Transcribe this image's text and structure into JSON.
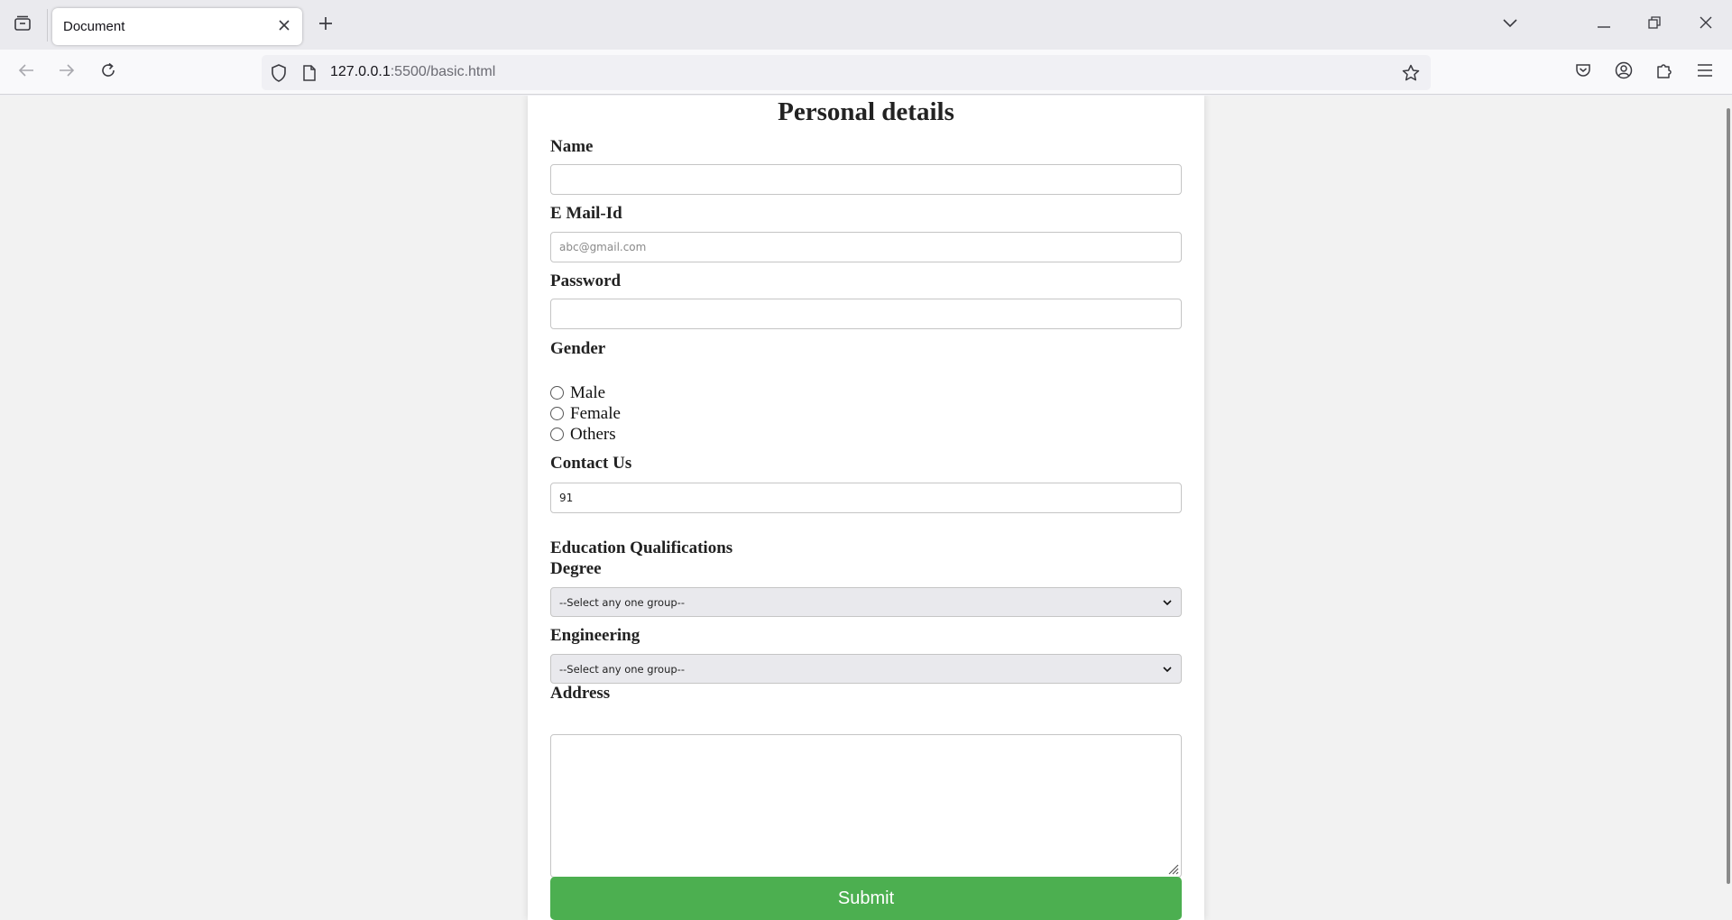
{
  "browser": {
    "tab_title": "Document",
    "url_host": "127.0.0.1",
    "url_path": ":5500/basic.html",
    "icons": [
      "tab-list-icon",
      "close-icon",
      "plus-icon",
      "chevron-down-icon",
      "minimize-icon",
      "restore-icon",
      "window-close-icon",
      "back-arrow-icon",
      "forward-arrow-icon",
      "reload-icon",
      "shield-icon",
      "page-icon",
      "star-icon",
      "pocket-icon",
      "account-icon",
      "extensions-icon",
      "menu-icon"
    ]
  },
  "form": {
    "title": "Personal details",
    "name_label": "Name",
    "name_value": "",
    "email_label": "E Mail-Id",
    "email_placeholder": "abc@gmail.com",
    "password_label": "Password",
    "password_value": "",
    "gender_label": "Gender",
    "gender_options": [
      "Male",
      "Female",
      "Others"
    ],
    "contact_label": "Contact Us",
    "contact_value": "91",
    "education_label": "Education Qualifications",
    "degree_label": "Degree",
    "degree_selected": "--Select any one group--",
    "engineering_label": "Engineering",
    "engineering_selected": "--Select any one group--",
    "address_label": "Address",
    "address_value": "",
    "submit_label": "Submit",
    "submit_color": "#4caf50"
  }
}
